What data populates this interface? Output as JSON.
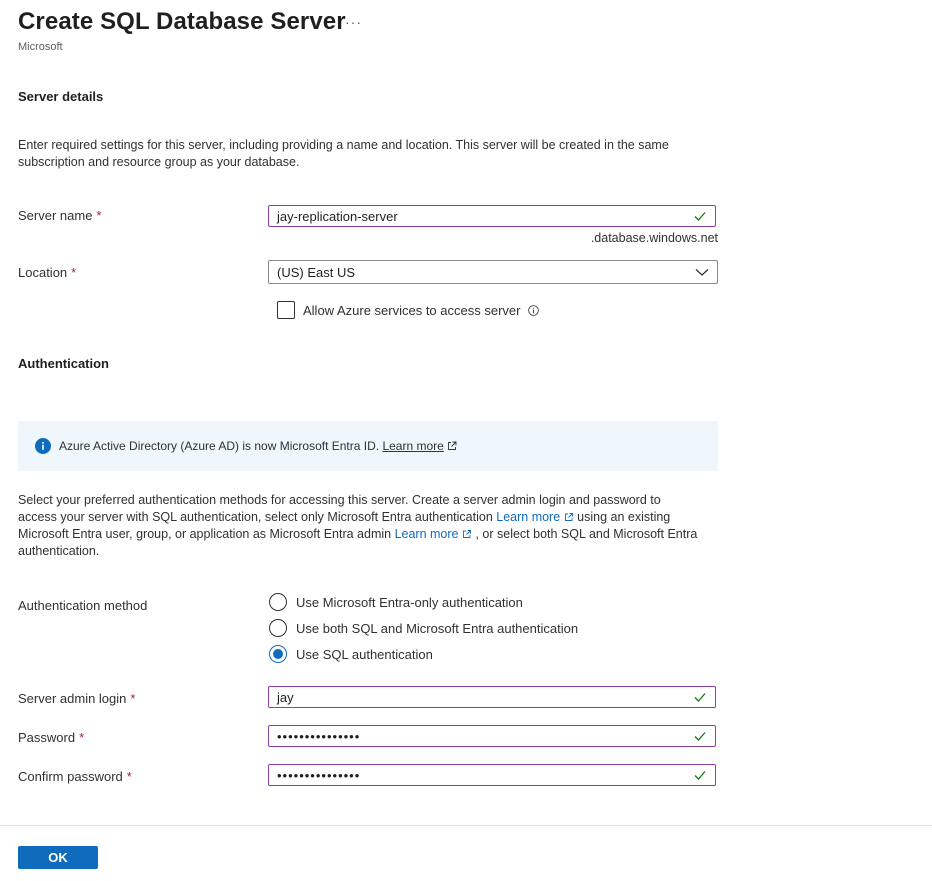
{
  "header": {
    "title": "Create SQL Database Server",
    "more": "···",
    "subtitle": "Microsoft"
  },
  "server_details": {
    "heading": "Server details",
    "description": "Enter required settings for this server, including providing a name and location. This server will be created in the same subscription and resource group as your database.",
    "server_name": {
      "label": "Server name",
      "required": "*",
      "value": "jay-replication-server",
      "suffix": ".database.windows.net"
    },
    "location": {
      "label": "Location",
      "required": "*",
      "value": "(US) East US"
    },
    "allow_azure": {
      "label": "Allow Azure services to access server",
      "checked": false
    }
  },
  "authentication": {
    "heading": "Authentication",
    "banner": {
      "text": "Azure Active Directory (Azure AD) is now Microsoft Entra ID.",
      "link": "Learn more"
    },
    "description": {
      "part1": "Select your preferred authentication methods for accessing this server. Create a server admin login and password to access your server with SQL authentication, select only Microsoft Entra authentication ",
      "link1": "Learn more",
      "part2": " using an existing Microsoft Entra user, group, or application as Microsoft Entra admin ",
      "link2": "Learn more",
      "part3": " , or select both SQL and Microsoft Entra authentication."
    },
    "method": {
      "label": "Authentication method",
      "options": [
        {
          "label": "Use Microsoft Entra-only authentication",
          "selected": false
        },
        {
          "label": "Use both SQL and Microsoft Entra authentication",
          "selected": false
        },
        {
          "label": "Use SQL authentication",
          "selected": true
        }
      ]
    },
    "admin_login": {
      "label": "Server admin login",
      "required": "*",
      "value": "jay"
    },
    "password": {
      "label": "Password",
      "required": "*",
      "value": "•••••••••••••••"
    },
    "confirm_password": {
      "label": "Confirm password",
      "required": "*",
      "value": "•••••••••••••••"
    }
  },
  "footer": {
    "ok_label": "OK"
  },
  "colors": {
    "accent": "#0f6cbd",
    "valid": "#107c10",
    "focus_border": "#8a3ea8",
    "required": "#a4262c",
    "banner_bg": "#eff6fc"
  }
}
